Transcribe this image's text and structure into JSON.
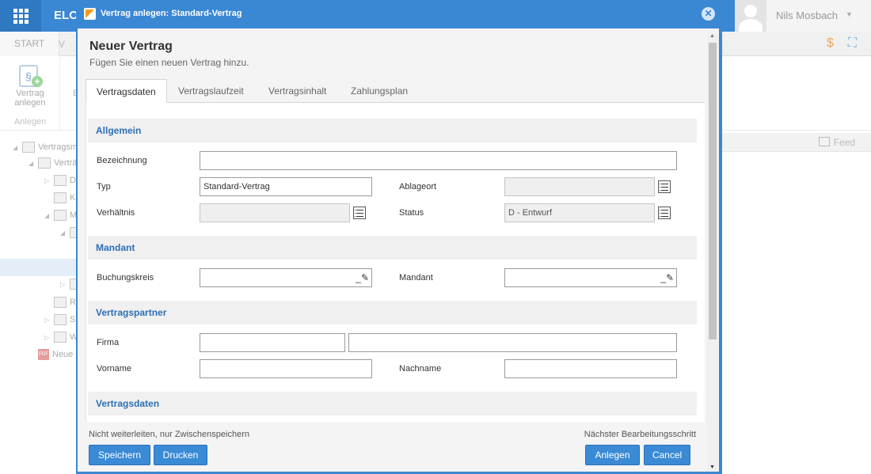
{
  "app": {
    "title": "ELO",
    "user_name": "Nils Mosbach",
    "ribbon": {
      "tabs": [
        "START",
        "V"
      ],
      "button_label": "Vertrag anlegen",
      "group_label": "Anlegen",
      "second_button_initial": "E"
    },
    "feed_label": "Feed",
    "tree": [
      {
        "label": "Vertragsm",
        "type": "folder",
        "expanded": true
      },
      {
        "label": "Verträ",
        "type": "folder",
        "expanded": true
      },
      {
        "label": "D",
        "type": "folder",
        "expanded": false
      },
      {
        "label": "K",
        "type": "folder"
      },
      {
        "label": "M",
        "type": "folder",
        "expanded": true
      },
      {
        "label": "",
        "type": "folder",
        "expanded": true
      },
      {
        "label": "",
        "type": "folder",
        "expanded": false
      },
      {
        "label": "R",
        "type": "folder"
      },
      {
        "label": "S",
        "type": "folder",
        "expanded": false
      },
      {
        "label": "W",
        "type": "folder",
        "expanded": false
      },
      {
        "label": "Neue",
        "type": "pdf"
      }
    ]
  },
  "dialog": {
    "title": "Vertrag anlegen: Standard-Vertrag",
    "heading": "Neuer Vertrag",
    "subheading": "Fügen Sie einen neuen Vertrag hinzu.",
    "tabs": [
      "Vertragsdaten",
      "Vertragslaufzeit",
      "Vertragsinhalt",
      "Zahlungsplan"
    ],
    "active_tab": "Vertragsdaten",
    "sections": {
      "allgemein": "Allgemein",
      "mandant": "Mandant",
      "vertragspartner": "Vertragspartner",
      "vertragsdaten": "Vertragsdaten"
    },
    "fields": {
      "bezeichnung": {
        "label": "Bezeichnung",
        "value": ""
      },
      "typ": {
        "label": "Typ",
        "value": "Standard-Vertrag"
      },
      "ablageort": {
        "label": "Ablageort",
        "value": ""
      },
      "verhaeltnis": {
        "label": "Verhältnis",
        "value": ""
      },
      "status": {
        "label": "Status",
        "value": "D - Entwurf"
      },
      "buchungskreis": {
        "label": "Buchungskreis",
        "value": ""
      },
      "mandant": {
        "label": "Mandant",
        "value": ""
      },
      "firma": {
        "label": "Firma",
        "value": "",
        "value2": ""
      },
      "vorname": {
        "label": "Vorname",
        "value": ""
      },
      "nachname": {
        "label": "Nachname",
        "value": ""
      }
    },
    "footer": {
      "left_text": "Nicht weiterleiten, nur Zwischenspeichern",
      "right_text": "Nächster Bearbeitungsschritt",
      "buttons": {
        "save": "Speichern",
        "print": "Drucken",
        "create": "Anlegen",
        "cancel": "Cancel"
      }
    }
  }
}
